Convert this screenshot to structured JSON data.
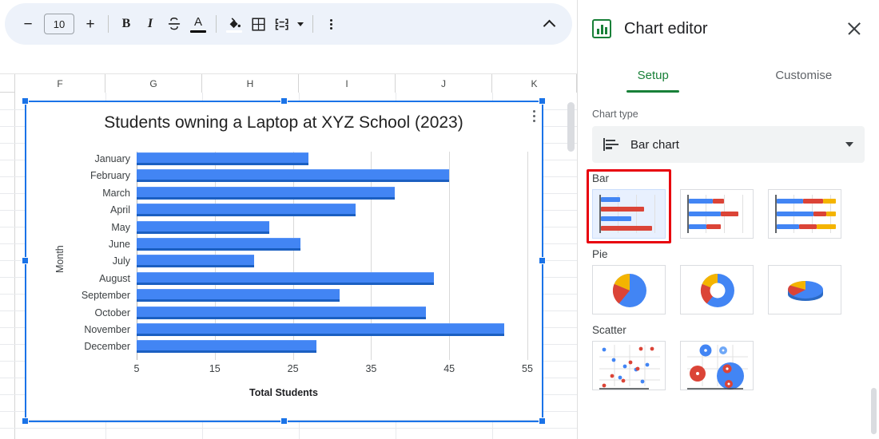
{
  "toolbar": {
    "zoom_out_label": "−",
    "font_size_value": "10",
    "zoom_in_label": "+",
    "bold_label": "B",
    "italic_label": "I",
    "strikethrough_label": "S",
    "text_color_label": "A",
    "icons": {
      "decrease_font": "minus-icon",
      "increase_font": "plus-icon",
      "bold": "bold-icon",
      "italic": "italic-icon",
      "strikethrough": "strikethrough-icon",
      "text_color": "text-color-icon",
      "fill_color": "fill-color-icon",
      "borders": "borders-icon",
      "merge_cells": "merge-cells-icon",
      "more_options": "more-options-icon",
      "collapse_toolbar": "chevron-up-icon"
    }
  },
  "sheet": {
    "column_headers": [
      "F",
      "G",
      "H",
      "I",
      "J",
      "K"
    ],
    "chart_menu_icon": "chart-kebab-icon"
  },
  "chart_data": {
    "type": "bar",
    "title": "Students owning a Laptop at XYZ School (2023)",
    "xlabel": "Total Students",
    "ylabel": "Month",
    "orientation": "horizontal",
    "categories": [
      "January",
      "February",
      "March",
      "April",
      "May",
      "June",
      "July",
      "August",
      "September",
      "October",
      "November",
      "December"
    ],
    "values": [
      27,
      45,
      38,
      33,
      22,
      26,
      20,
      43,
      31,
      42,
      52,
      28
    ],
    "xticks": [
      5,
      15,
      25,
      35,
      45,
      55
    ],
    "xlim": [
      5,
      56
    ],
    "grid": true,
    "legend": "none",
    "series_color": "#4285f4"
  },
  "editor": {
    "title": "Chart editor",
    "icon": "bar-chart-icon",
    "close_icon": "close-icon",
    "tabs": [
      {
        "label": "Setup",
        "active": true
      },
      {
        "label": "Customise",
        "active": false
      }
    ],
    "chart_type_label": "Chart type",
    "chart_type_value": "Bar chart",
    "dropdown_icon": "chevron-down-icon",
    "groups": [
      {
        "name": "Bar",
        "highlighted": true,
        "options": [
          {
            "name": "bar-chart-option",
            "selected": true
          },
          {
            "name": "stacked-bar-chart-option",
            "selected": false
          },
          {
            "name": "100-percent-stacked-bar-chart-option",
            "selected": false
          }
        ]
      },
      {
        "name": "Pie",
        "highlighted": false,
        "options": [
          {
            "name": "pie-chart-option",
            "selected": false
          },
          {
            "name": "doughnut-chart-option",
            "selected": false
          },
          {
            "name": "3d-pie-chart-option",
            "selected": false
          }
        ]
      },
      {
        "name": "Scatter",
        "highlighted": false,
        "options": [
          {
            "name": "scatter-chart-option",
            "selected": false
          },
          {
            "name": "bubble-chart-option",
            "selected": false
          }
        ]
      }
    ],
    "highlight_color": "#e8000d",
    "accent_color": "#188038"
  }
}
